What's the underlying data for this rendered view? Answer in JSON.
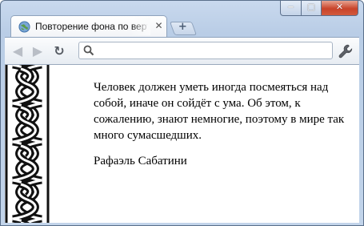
{
  "tab": {
    "title": "Повторение фона по вертикали",
    "close_glyph": "✕"
  },
  "window_controls": {
    "minimize": "‒",
    "maximize": "▢",
    "close": "✕"
  },
  "toolbar": {
    "back": "◀",
    "forward": "▶",
    "reload": "↻"
  },
  "omnibox": {
    "value": "",
    "placeholder": ""
  },
  "content": {
    "paragraph": "Человек должен уметь иногда посмеяться над собой, иначе он сойдёт с ума. Об этом, к сожалению, знают немногие, поэтому в мире так много сумасшедших.",
    "author": "Рафаэль Сабатини"
  },
  "icons": [
    "globe-icon",
    "close-icon",
    "plus-icon",
    "back-arrow-icon",
    "forward-arrow-icon",
    "reload-icon",
    "search-icon",
    "wrench-icon",
    "minimize-icon",
    "maximize-icon"
  ],
  "colors": {
    "frame": "#c2d4ea",
    "close_button": "#c8432a",
    "page_bg": "#ffffff"
  }
}
